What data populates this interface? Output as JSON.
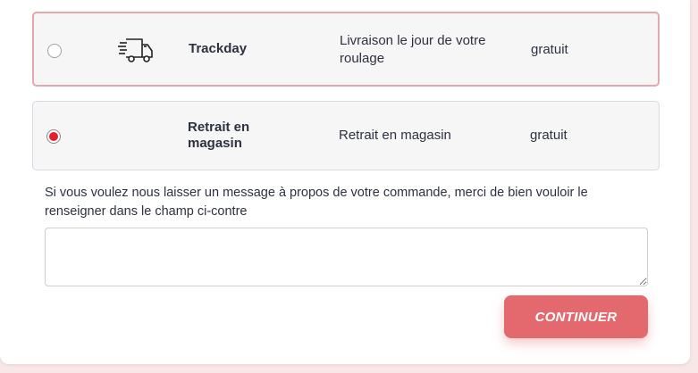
{
  "shipping_options": [
    {
      "name": "Trackday",
      "description": "Livraison le jour de votre roulage",
      "price": "gratuit",
      "icon": "delivery-truck-icon",
      "selected": false
    },
    {
      "name": "Retrait en magasin",
      "description": "Retrait en magasin",
      "price": "gratuit",
      "selected": true
    }
  ],
  "message": {
    "label": "Si vous voulez nous laisser un message à propos de votre commande, merci de bien vouloir le renseigner dans le champ ci-contre",
    "value": ""
  },
  "continue_button": {
    "label": "CONTINUER"
  },
  "colors": {
    "accent": "#e4696f",
    "radio_checked": "#e32228",
    "option_bg": "#f6f6f6"
  }
}
